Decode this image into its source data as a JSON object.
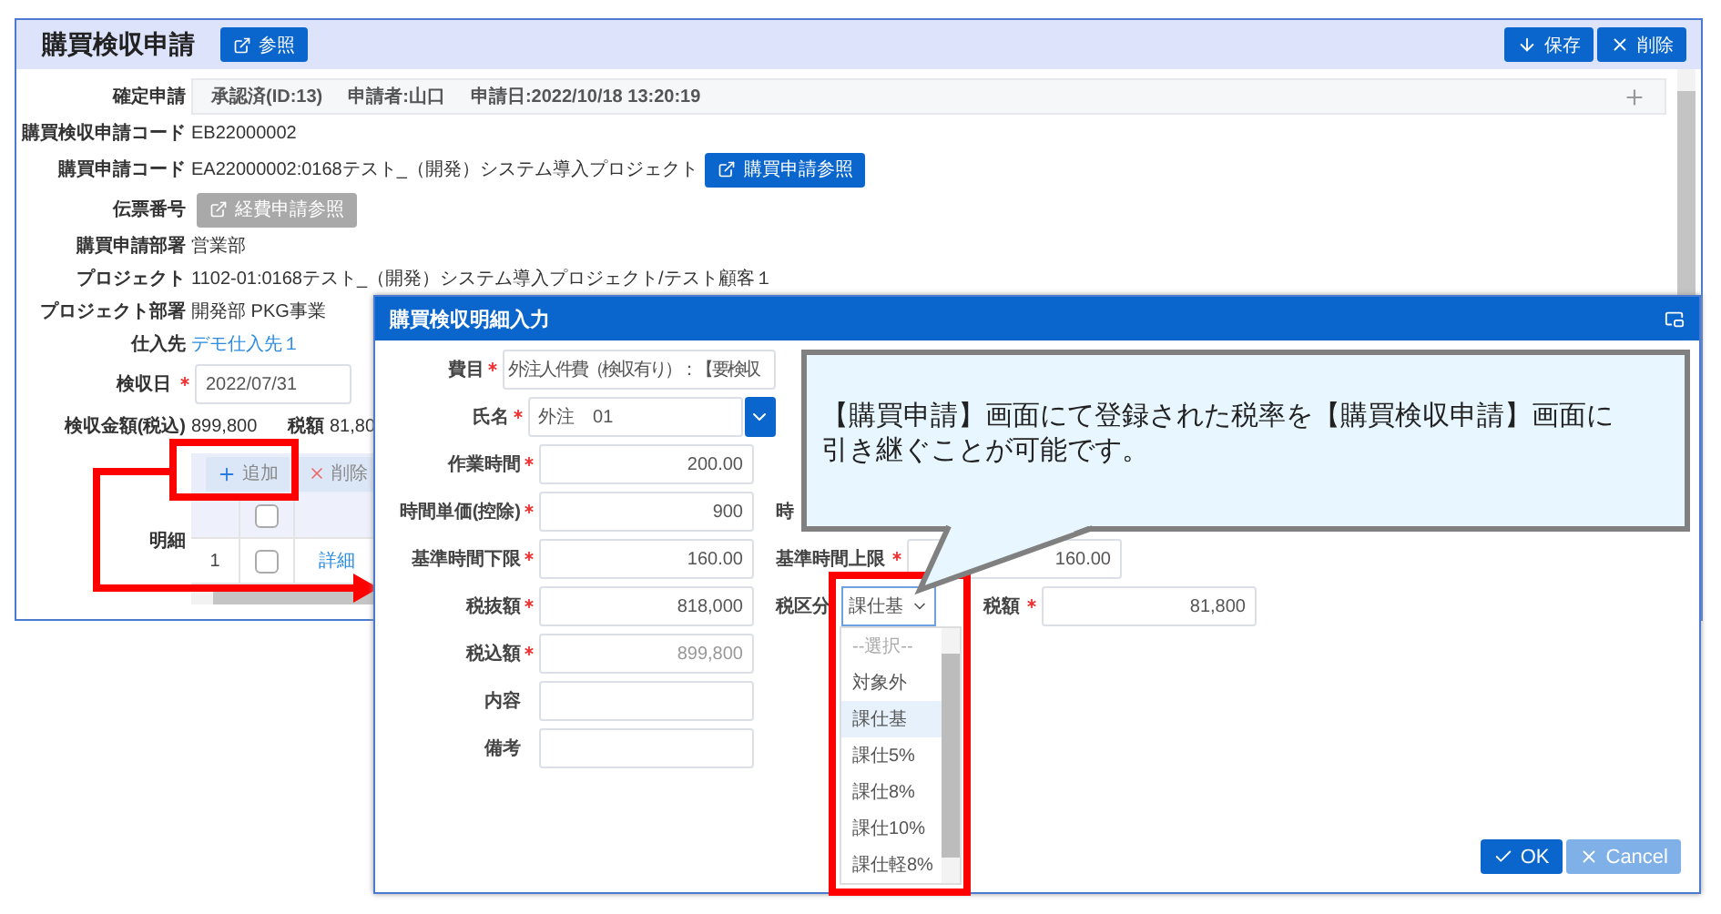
{
  "main": {
    "title": "購買検収申請",
    "title_button": {
      "label": "参照"
    },
    "actions": [
      {
        "label": "保存"
      },
      {
        "label": "削除"
      }
    ],
    "fields": [
      {
        "kind": "status",
        "label": "確定申請",
        "parts": [
          "承認済(ID:13)",
          "申請者:山口",
          "申請日:2022/10/18 13:20:19"
        ]
      },
      {
        "kind": "text",
        "label": "購買検収申請コード",
        "value": "EB22000002"
      },
      {
        "kind": "text_button",
        "label": "購買申請コード",
        "value": "EA22000002:0168テスト_（開発）システム導入プロジェクト",
        "button": {
          "label": "購買申請参照",
          "disabled": false
        }
      },
      {
        "kind": "button",
        "label": "伝票番号",
        "button": {
          "label": "経費申請参照",
          "disabled": true
        }
      },
      {
        "kind": "text",
        "label": "購買申請部署",
        "value": "営業部"
      },
      {
        "kind": "text",
        "label": "プロジェクト",
        "value": "1102-01:0168テスト_（開発）システム導入プロジェクト/テスト顧客１"
      },
      {
        "kind": "text",
        "label": "プロジェクト部署",
        "value": "開発部 PKG事業"
      },
      {
        "kind": "link",
        "label": "仕入先",
        "value": "デモ仕入先１"
      },
      {
        "kind": "date",
        "label": "検収日",
        "required": true,
        "value": "2022/07/31"
      },
      {
        "kind": "amounts",
        "label": "検収金額(税込)",
        "value": "899,800",
        "label2": "税額",
        "value2": "81,80"
      }
    ],
    "detail": {
      "label": "明細",
      "toolbar": [
        {
          "label": "追加"
        },
        {
          "label": "削除"
        }
      ],
      "header_checked": false,
      "rows": [
        {
          "no": "1",
          "checked": false,
          "link": "詳細"
        }
      ]
    }
  },
  "dialog": {
    "title": "購買検収明細入力",
    "rows": [
      {
        "label": "費目",
        "required": true,
        "field": {
          "kind": "wide",
          "value": "外注人件費（検収有り）：【要検収"
        }
      },
      {
        "label": "氏名",
        "required": true,
        "field": {
          "kind": "combo",
          "value": "外注　01"
        }
      },
      {
        "label": "作業時間",
        "required": true,
        "field": {
          "kind": "number",
          "value": "200.00"
        }
      },
      {
        "label": "時間単価(控除)",
        "required": true,
        "field": {
          "kind": "number",
          "value": "900"
        },
        "right": [
          {
            "label": "時"
          }
        ]
      },
      {
        "label": "基準時間下限",
        "required": true,
        "field": {
          "kind": "number",
          "value": "160.00"
        },
        "right": [
          {
            "label": "基準時間上限",
            "required": true,
            "field": {
              "kind": "number",
              "value": "160.00"
            }
          }
        ]
      },
      {
        "label": "税抜額",
        "required": true,
        "field": {
          "kind": "number",
          "value": "818,000"
        },
        "right": [
          {
            "label": "税区分",
            "field": {
              "kind": "select",
              "value": "課仕基"
            }
          },
          {
            "label": "税額",
            "required": true,
            "field": {
              "kind": "number",
              "value": "81,800"
            }
          }
        ]
      },
      {
        "label": "税込額",
        "required": true,
        "field": {
          "kind": "number",
          "value": "899,800",
          "disabled": true
        }
      },
      {
        "label": "内容",
        "required": false,
        "field": {
          "kind": "text"
        }
      },
      {
        "label": "備考",
        "required": false,
        "field": {
          "kind": "text"
        }
      }
    ],
    "dropdown": [
      {
        "label": "--選択--",
        "placeholder": true,
        "selected": false
      },
      {
        "label": "対象外",
        "placeholder": false,
        "selected": false
      },
      {
        "label": "課仕基",
        "placeholder": false,
        "selected": true
      },
      {
        "label": "課仕5%",
        "placeholder": false,
        "selected": false
      },
      {
        "label": "課仕8%",
        "placeholder": false,
        "selected": false
      },
      {
        "label": "課仕10%",
        "placeholder": false,
        "selected": false
      },
      {
        "label": "課仕軽8%",
        "placeholder": false,
        "selected": false
      }
    ],
    "buttons": [
      {
        "label": "OK",
        "kind": "primary"
      },
      {
        "label": "Cancel",
        "kind": "secondary"
      }
    ]
  },
  "callout": {
    "text": "【購買申請】画面にて登録された税率を【購買検収申請】画面に引き継ぐことが可能です。"
  }
}
